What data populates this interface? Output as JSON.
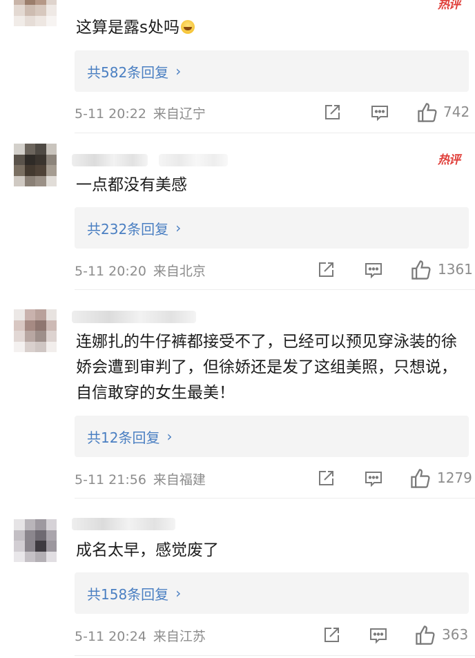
{
  "comments": [
    {
      "text": "这算是露s处吗",
      "hot_badge": "热评",
      "replies_label": "共582条回复",
      "chevron": "›",
      "time": "5-11 20:22",
      "location": "来自辽宁",
      "likes": "742",
      "emoji_icon": "laughing-crying-emoji-icon"
    },
    {
      "text": "一点都没有美感",
      "hot_badge": "热评",
      "replies_label": "共232条回复",
      "chevron": "›",
      "time": "5-11 20:20",
      "location": "来自北京",
      "likes": "1361"
    },
    {
      "text": "连娜扎的牛仔裤都接受不了，已经可以预见穿泳装的徐娇会遭到审判了，但徐娇还是发了这组美照，只想说，自信敢穿的女生最美！",
      "replies_label": "共12条回复",
      "chevron": "›",
      "time": "5-11 21:56",
      "location": "来自福建",
      "likes": "1279"
    },
    {
      "text": "成名太早，感觉废了",
      "replies_label": "共158条回复",
      "chevron": "›",
      "time": "5-11 20:24",
      "location": "来自江苏",
      "likes": "363"
    }
  ],
  "colors": {
    "reply_link": "#4a7fc2",
    "hot_badge": "#e0403b",
    "meta_text": "#8c8c8c",
    "reply_box_bg": "#f4f4f4"
  },
  "icons": [
    "share-icon",
    "comment-icon",
    "thumbs-up-icon"
  ]
}
